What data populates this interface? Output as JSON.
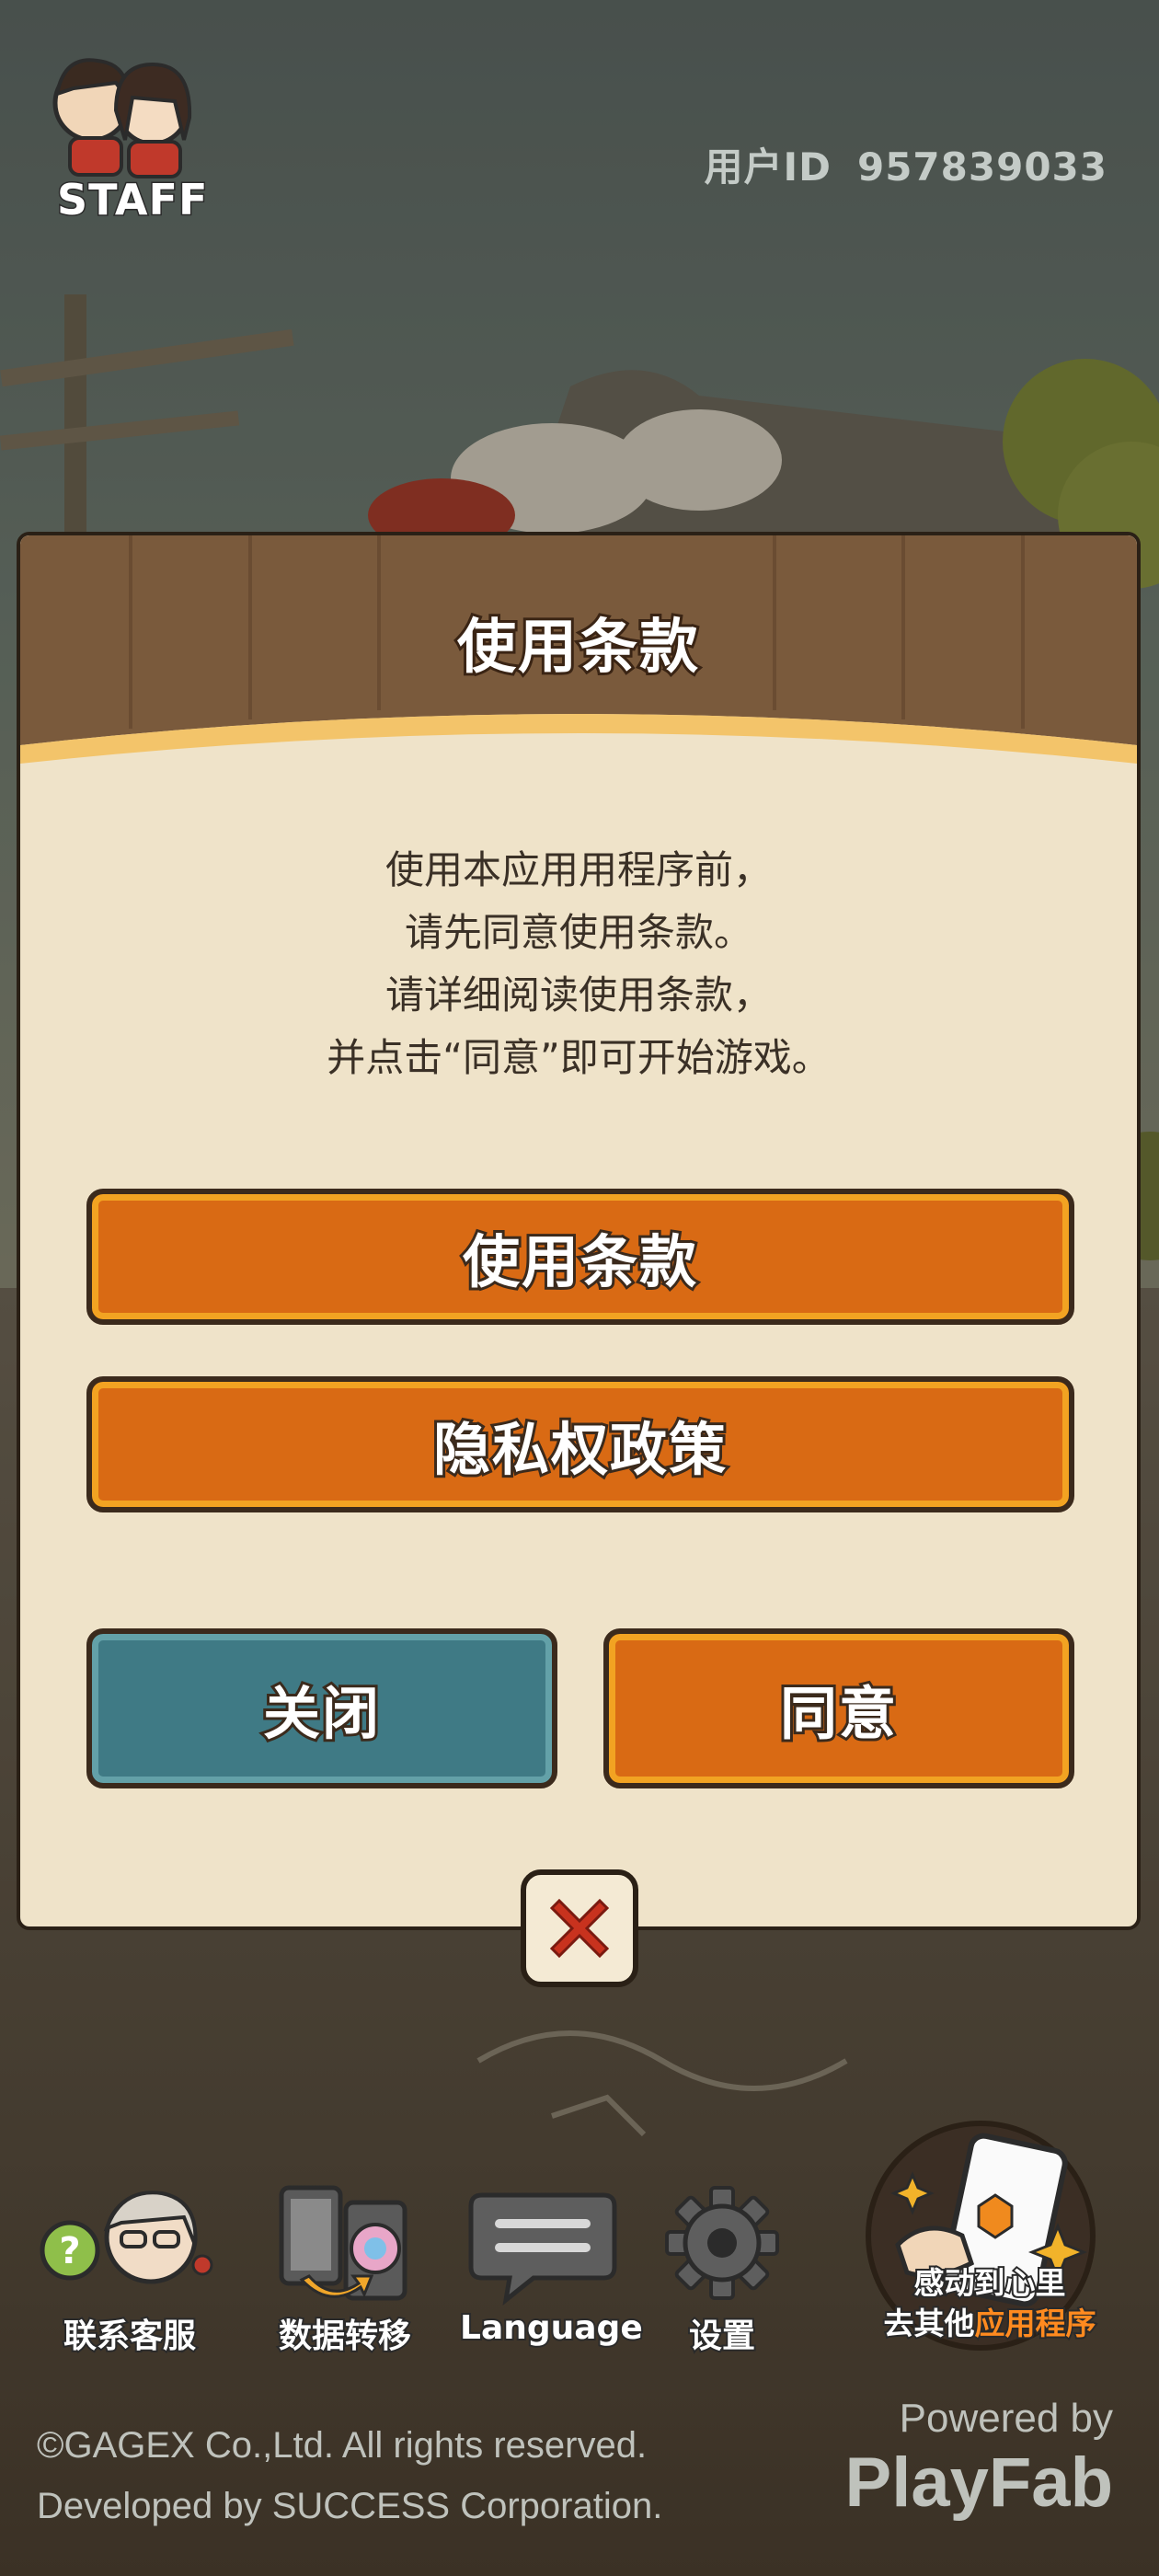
{
  "header": {
    "staff_label": "STAFF",
    "user_id_label": "用户ID",
    "user_id_value": "957839033"
  },
  "dialog": {
    "title": "使用条款",
    "intro_lines": [
      "使用本应用用程序前，",
      "请先同意使用条款。",
      "请详细阅读使用条款，",
      "并点击“同意”即可开始游戏。"
    ],
    "terms_button": "使用条款",
    "privacy_button": "隐私权政策",
    "close_button": "关闭",
    "agree_button": "同意"
  },
  "toolbar": {
    "support_label": "联系客服",
    "transfer_label": "数据转移",
    "language_label": "Language",
    "settings_label": "设置",
    "promo_line1": "感动到心里",
    "promo_line2_prefix": "去其他",
    "promo_line2_highlight": "应用程序",
    "promo_logo": "GAGEX"
  },
  "footer": {
    "copyright": "©GAGEX Co.,Ltd. All rights reserved.",
    "developer": "Developed by SUCCESS Corporation.",
    "powered_by": "Powered by",
    "powered_brand": "PlayFab"
  },
  "colors": {
    "orange_button": "#d96a14",
    "teal_button": "#3f7a85",
    "dialog_bg": "#efe3c9",
    "header_brown": "#7a5a3c",
    "close_x_red": "#c8321e"
  },
  "icons": [
    "staff-avatars-icon",
    "support-agent-icon",
    "data-transfer-icon",
    "language-speech-icon",
    "settings-gear-icon",
    "close-x-icon",
    "gagex-phone-icon"
  ]
}
